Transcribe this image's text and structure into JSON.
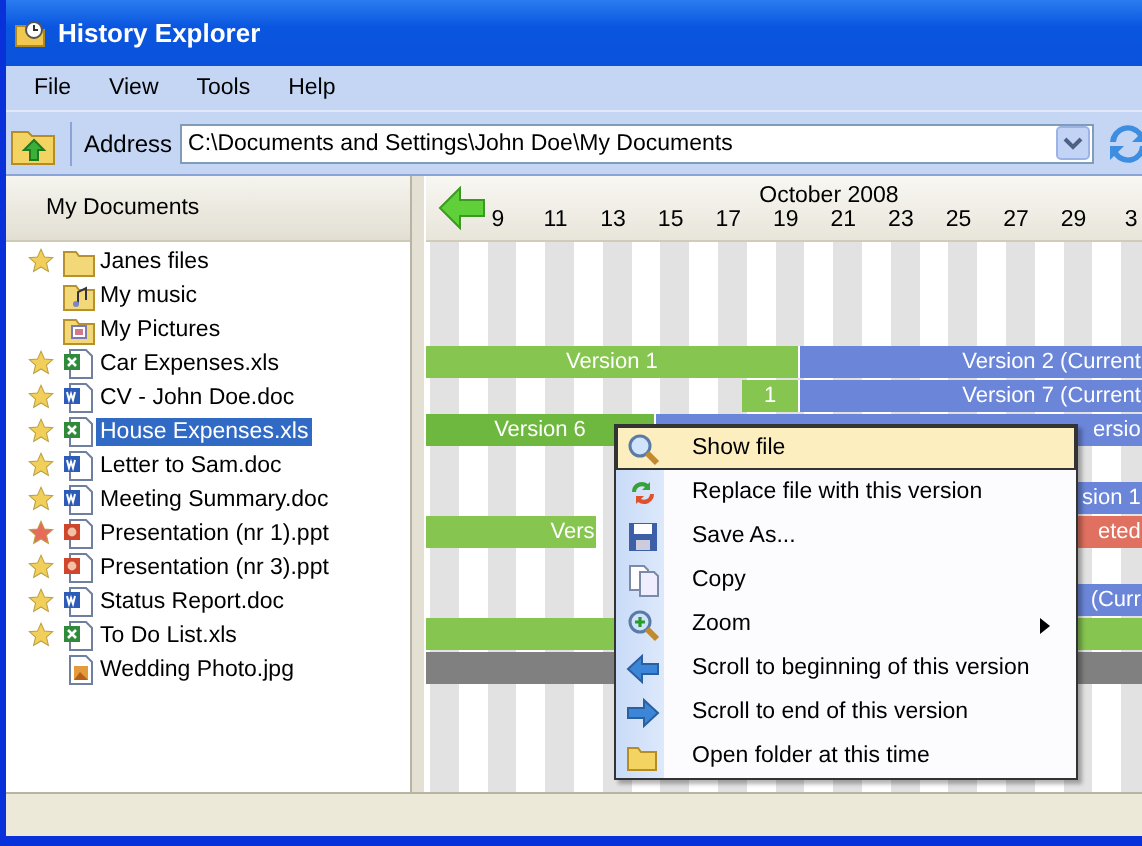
{
  "window": {
    "title": "History Explorer"
  },
  "menu": [
    "File",
    "View",
    "Tools",
    "Help"
  ],
  "address": {
    "label": "Address",
    "value": "C:\\Documents and Settings\\John Doe\\My Documents"
  },
  "tree": {
    "header": "My Documents",
    "items": [
      {
        "name": "Janes files",
        "kind": "folder",
        "color": "#f2cf5b",
        "selected": false
      },
      {
        "name": "My music",
        "kind": "music-folder",
        "selected": false
      },
      {
        "name": "My Pictures",
        "kind": "pictures-folder",
        "selected": false
      },
      {
        "name": "Car Expenses.xls",
        "kind": "spreadsheet",
        "color": "#f2cf5b",
        "selected": false,
        "versions": [
          {
            "label": "Version 1",
            "color": "#86c550"
          },
          {
            "label": "Version 2 (Current",
            "color": "#6b86d9"
          }
        ]
      },
      {
        "name": "CV - John Doe.doc",
        "kind": "document",
        "color": "#f2cf5b",
        "selected": false,
        "versions": [
          {
            "label": "1",
            "color": "#86c550"
          },
          {
            "label": "Version 7 (Current",
            "color": "#6b86d9"
          }
        ]
      },
      {
        "name": "House Expenses.xls",
        "kind": "spreadsheet",
        "color": "#f2cf5b",
        "selected": true,
        "versions": [
          {
            "label": "Version 6",
            "color": "#6fb83f"
          },
          {
            "label": "ersio",
            "color": "#6b86d9"
          }
        ]
      },
      {
        "name": "Letter to Sam.doc",
        "kind": "document",
        "color": "#f2cf5b",
        "selected": false
      },
      {
        "name": "Meeting Summary.doc",
        "kind": "document",
        "color": "#f2cf5b",
        "selected": false,
        "versions": [
          {
            "label": "sion 1",
            "color": "#6b86d9"
          }
        ]
      },
      {
        "name": "Presentation (nr 1).ppt",
        "kind": "presentation",
        "color": "#e86a5c",
        "selected": false,
        "versions": [
          {
            "label": "Vers",
            "color": "#86c550"
          },
          {
            "label": "eted",
            "color": "#e0705f"
          }
        ]
      },
      {
        "name": "Presentation (nr 3).ppt",
        "kind": "presentation",
        "color": "#f2cf5b",
        "selected": false
      },
      {
        "name": "Status Report.doc",
        "kind": "document",
        "color": "#f2cf5b",
        "selected": false,
        "versions": [
          {
            "label": "(Curr",
            "color": "#6b86d9"
          }
        ]
      },
      {
        "name": "To Do List.xls",
        "kind": "spreadsheet",
        "color": "#f2cf5b",
        "selected": false,
        "versions": [
          {
            "color": "#86c550"
          }
        ]
      },
      {
        "name": "Wedding Photo.jpg",
        "kind": "image",
        "selected": false,
        "versions": [
          {
            "color": "#808080"
          }
        ]
      }
    ]
  },
  "timeline": {
    "month": "October 2008",
    "days": [
      "9",
      "11",
      "13",
      "15",
      "17",
      "19",
      "21",
      "23",
      "25",
      "27",
      "29",
      "3"
    ]
  },
  "context_menu": [
    {
      "label": "Show file",
      "selected": true,
      "submenu": false
    },
    {
      "label": "Replace file with this version",
      "selected": false,
      "submenu": false
    },
    {
      "label": "Save As...",
      "selected": false,
      "submenu": false
    },
    {
      "label": "Copy",
      "selected": false,
      "submenu": false
    },
    {
      "label": "Zoom",
      "selected": false,
      "submenu": true
    },
    {
      "label": "Scroll to beginning of this version",
      "selected": false,
      "submenu": false
    },
    {
      "label": "Scroll to end of this version",
      "selected": false,
      "submenu": false
    },
    {
      "label": "Open folder at this time",
      "selected": false,
      "submenu": false
    }
  ]
}
